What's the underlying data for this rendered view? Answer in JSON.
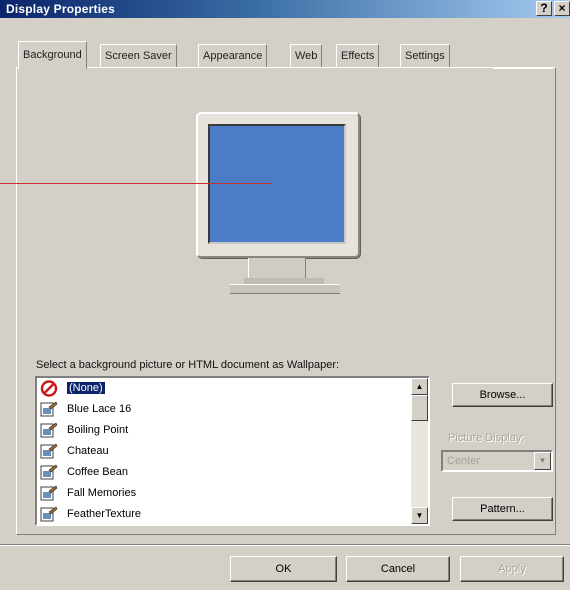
{
  "window": {
    "title": "Display Properties",
    "help_glyph": "?",
    "close_glyph": "×"
  },
  "tabs": [
    {
      "label": "Background",
      "active": true
    },
    {
      "label": "Screen Saver",
      "active": false
    },
    {
      "label": "Appearance",
      "active": false
    },
    {
      "label": "Web",
      "active": false
    },
    {
      "label": "Effects",
      "active": false
    },
    {
      "label": "Settings",
      "active": false
    }
  ],
  "preview": {
    "screen_color": "#4a7dc6"
  },
  "wallpaper": {
    "label": "Select a background picture or HTML document as Wallpaper:",
    "items": [
      {
        "label": "(None)",
        "icon": "none-icon",
        "selected": true
      },
      {
        "label": "Blue Lace 16",
        "icon": "picture-icon",
        "selected": false
      },
      {
        "label": "Boiling Point",
        "icon": "picture-icon",
        "selected": false
      },
      {
        "label": "Chateau",
        "icon": "picture-icon",
        "selected": false
      },
      {
        "label": "Coffee Bean",
        "icon": "picture-icon",
        "selected": false
      },
      {
        "label": "Fall Memories",
        "icon": "picture-icon",
        "selected": false
      },
      {
        "label": "FeatherTexture",
        "icon": "picture-icon",
        "selected": false
      }
    ]
  },
  "side_controls": {
    "browse_label": "Browse...",
    "picture_display_label": "Picture Display:",
    "picture_display_value": "Center",
    "pattern_label": "Pattern..."
  },
  "footer": {
    "ok_label": "OK",
    "cancel_label": "Cancel",
    "apply_label": "Apply"
  }
}
